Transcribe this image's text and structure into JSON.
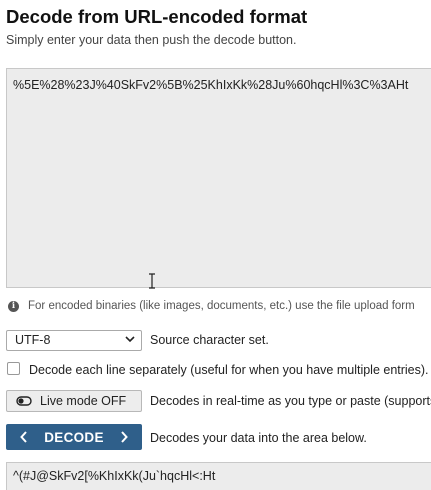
{
  "header": {
    "title": "Decode from URL-encoded format",
    "subtitle": "Simply enter your data then push the decode button."
  },
  "input": {
    "value": "%5E%28%23J%40SkFv2%5B%25KhIxKk%28Ju%60hqcHl%3C%3AHt"
  },
  "info": {
    "text": "For encoded binaries (like images, documents, etc.) use the file upload form"
  },
  "charset": {
    "selected": "UTF-8",
    "label": "Source character set."
  },
  "separate_lines": {
    "label": "Decode each line separately (useful for when you have multiple entries)."
  },
  "live_mode": {
    "button_label": "Live mode OFF",
    "description": "Decodes in real-time as you type or paste (supports only"
  },
  "decode": {
    "button_label": "DECODE",
    "description": "Decodes your data into the area below."
  },
  "output": {
    "value": "^(#J@SkFv2[%KhIxKk(Ju`hqcHl<:Ht"
  },
  "colors": {
    "decode_button": "#2f5f8a",
    "textarea_bg": "#ececec"
  }
}
